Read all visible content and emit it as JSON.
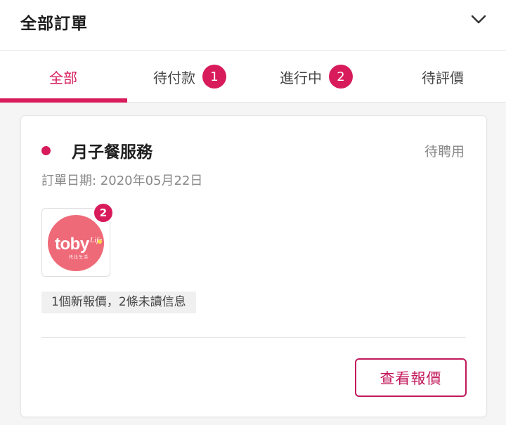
{
  "header": {
    "title": "全部訂單",
    "expand_icon": "chevron-down-icon"
  },
  "tabs": [
    {
      "label": "全部",
      "active": true,
      "badge": null
    },
    {
      "label": "待付款",
      "active": false,
      "badge": "1"
    },
    {
      "label": "進行中",
      "active": false,
      "badge": "2"
    },
    {
      "label": "待評價",
      "active": false,
      "badge": null
    }
  ],
  "order": {
    "service_name": "月子餐服務",
    "status": "待聘用",
    "date": "訂單日期: 2020年05月22日",
    "vendor_logo": {
      "text": "toby",
      "sub": "Life",
      "tag": "托比生活"
    },
    "unread_count": "2",
    "message_summary": "1個新報價，2條未讀信息",
    "action_label": "查看報價"
  },
  "colors": {
    "accent": "#d81b5a",
    "logo_bg": "#ef6a78"
  }
}
